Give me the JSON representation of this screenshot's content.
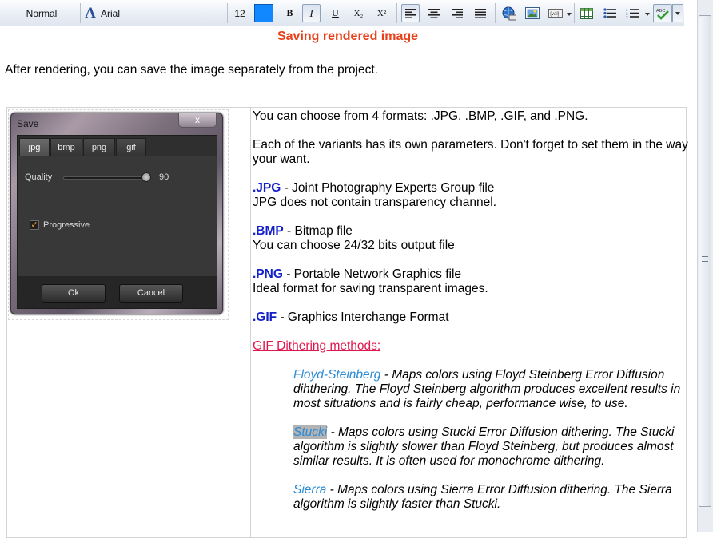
{
  "toolbar": {
    "style_value": "Normal",
    "font_value": "Arial",
    "size_value": "12",
    "font_color": "#1188ff",
    "bold": "B",
    "italic": "I",
    "underline": "U",
    "subscript": "X₂",
    "superscript": "X²",
    "icons": [
      "font-icon",
      "bold-icon",
      "italic-icon",
      "underline-icon",
      "subscript-icon",
      "superscript-icon",
      "align-left-icon",
      "align-center-icon",
      "align-right-icon",
      "justify-icon",
      "hyperlink-icon",
      "image-icon",
      "field-icon",
      "table-icon",
      "bullets-icon",
      "numbering-icon",
      "spellcheck-icon"
    ]
  },
  "document": {
    "title": "Saving rendered image",
    "intro": "After rendering, you can save the image separately from the project.",
    "formats_line": "You can choose from 4 formats: .JPG, .BMP, .GIF, and .PNG.",
    "params_line": "Each of the variants has its own parameters. Don't forget to set them in the way your want.",
    "jpg": {
      "key": ".JPG",
      "desc": " - Joint Photography Experts Group file",
      "note": "JPG does not contain transparency channel."
    },
    "bmp": {
      "key": ".BMP",
      "desc": " - Bitmap file",
      "note": "You can choose 24/32 bits output file"
    },
    "png": {
      "key": ".PNG",
      "desc": " - Portable Network Graphics file",
      "note": "Ideal format for saving transparent images."
    },
    "gif": {
      "key": ".GIF",
      "desc": " - Graphics Interchange Format"
    },
    "dithering_heading": "GIF Dithering methods:",
    "methods": [
      {
        "name": "Floyd-Steinberg",
        "desc": " - Maps colors using Floyd Steinberg Error Diffusion dihthering. The Floyd Steinberg algorithm produces excellent results in most situations and is fairly cheap, performance wise, to use."
      },
      {
        "name": "Stucki",
        "desc": " - Maps colors using Stucki Error Diffusion dithering. The Stucki algorithm is slightly slower than Floyd Steinberg, but produces almost similar results. It is often used for monochrome dithering."
      },
      {
        "name": "Sierra",
        "desc": " - Maps colors using Sierra Error Diffusion dithering. The Sierra algorithm is slightly faster than Stucki."
      }
    ],
    "colors": {
      "title": "#e8401a",
      "keyword": "#1420c8",
      "heading_link": "#e0174f",
      "method": "#2a8bd6"
    }
  },
  "dialog": {
    "title": "Save",
    "close": "x",
    "tabs": [
      "jpg",
      "bmp",
      "png",
      "gif"
    ],
    "active_tab": "jpg",
    "quality_label": "Quality",
    "quality_value": "90",
    "progressive_label": "Progressive",
    "progressive_checked": true,
    "ok_label": "Ok",
    "cancel_label": "Cancel"
  }
}
